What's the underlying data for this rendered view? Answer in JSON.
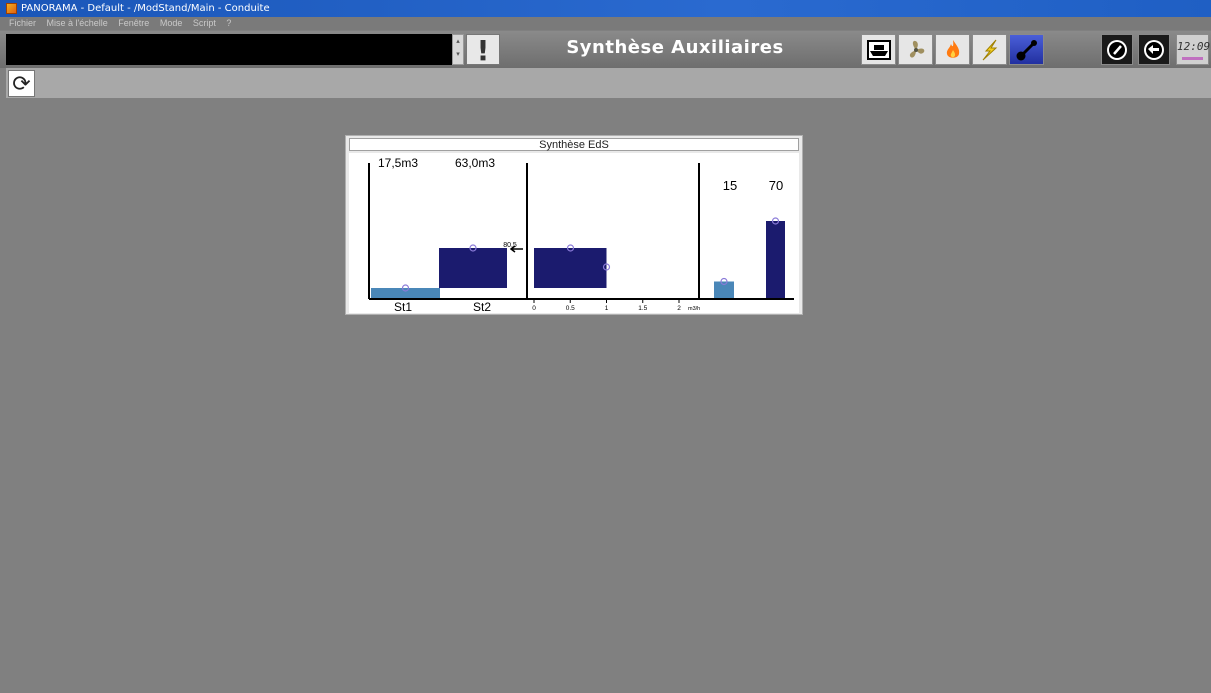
{
  "window": {
    "title": "PANORAMA - Default - /ModStand/Main - Conduite",
    "menu": [
      "Fichier",
      "Mise à l'échelle",
      "Fenêtre",
      "Mode",
      "Script",
      "?"
    ]
  },
  "header": {
    "title": "Synthèse Auxiliaires",
    "alert_symbol": "!",
    "toolbar_icons": [
      "ship-icon",
      "fan-icon",
      "flame-icon",
      "lightning-icon",
      "valve-icon",
      "gauge-icon",
      "back-icon"
    ],
    "clock": "12:09"
  },
  "panel": {
    "title": "Synthèse EdS",
    "tanks": {
      "labels": [
        "St1",
        "St2"
      ],
      "volumes": [
        "17,5m3",
        "63,0m3"
      ],
      "levels": [
        0.09,
        0.33
      ],
      "marker_label": "80,5",
      "colors": [
        "#4a87b8",
        "#1b1b6e"
      ]
    },
    "flow": {
      "ticks": [
        "0",
        "0.5",
        "1",
        "1.5",
        "2"
      ],
      "unit": "m3/h",
      "value": 1.0,
      "marker": 1.0
    },
    "right_bars": {
      "values": [
        "15",
        "70"
      ],
      "fractions": [
        0.15,
        0.7
      ],
      "colors": [
        "#4a87b8",
        "#1b1b6e"
      ]
    },
    "marker_color": "#8a7ad8"
  }
}
